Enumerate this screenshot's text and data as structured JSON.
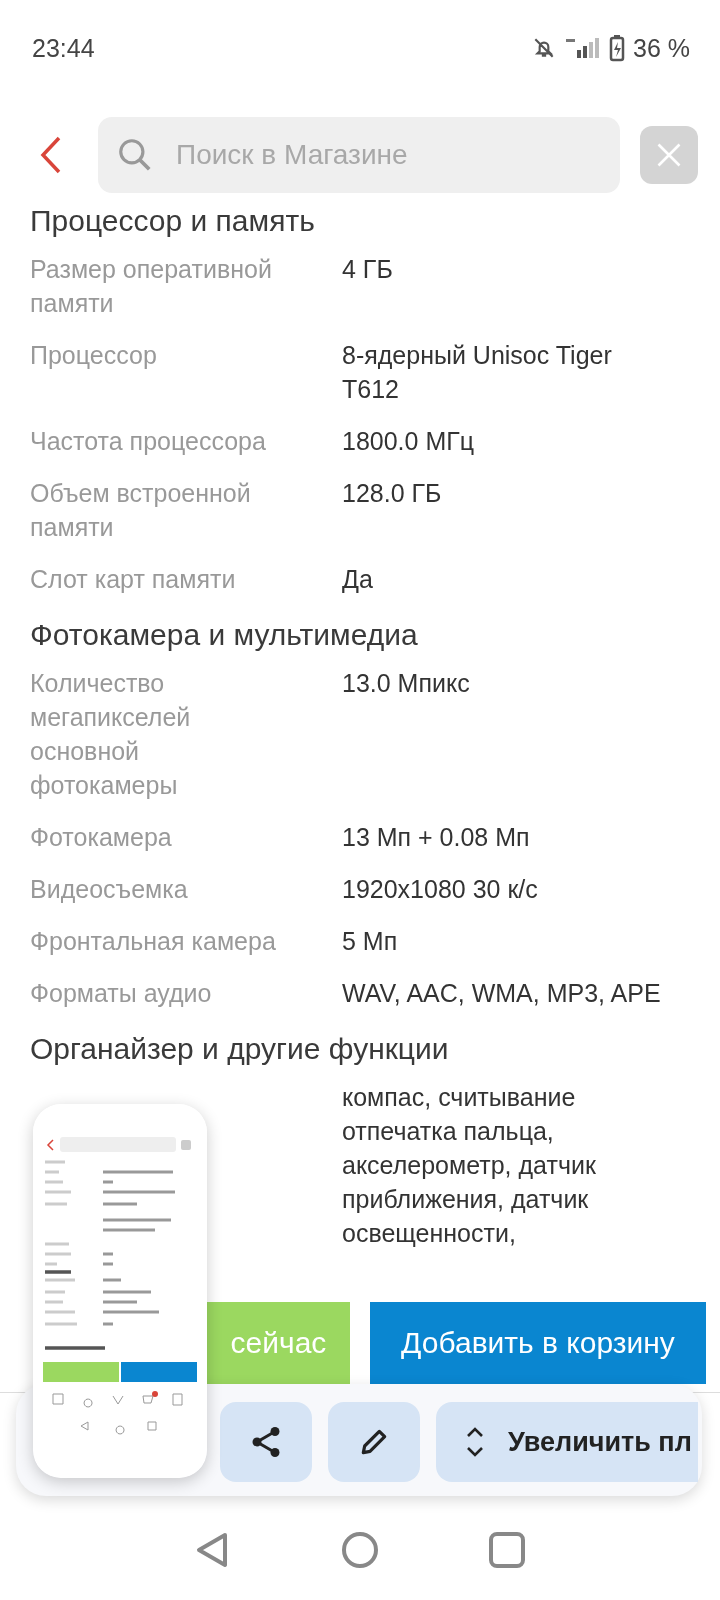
{
  "status_bar": {
    "time": "23:44",
    "battery": "36 %"
  },
  "header": {
    "search": {
      "placeholder": "Поиск в Магазине"
    }
  },
  "sections": [
    {
      "title": "Процессор и память",
      "rows": [
        {
          "label": "Размер оперативной памяти",
          "value": "4 ГБ"
        },
        {
          "label": "Процессор",
          "value": "8-ядерный Unisoc Tiger T612"
        },
        {
          "label": "Частота процессора",
          "value": "1800.0 МГц"
        },
        {
          "label": "Объем встроенной памяти",
          "value": "128.0 ГБ"
        },
        {
          "label": "Слот карт памяти",
          "value": "Да"
        }
      ]
    },
    {
      "title": "Фотокамера и мультимедиа",
      "rows": [
        {
          "label": "Количество мегапикселей основной фотокамеры",
          "value": "13.0 Мпикс"
        },
        {
          "label": "Фотокамера",
          "value": "13 Мп + 0.08 Мп"
        },
        {
          "label": "Видеосъемка",
          "value": "1920x1080 30 к/с"
        },
        {
          "label": "Фронтальная камера",
          "value": "5 Мп"
        },
        {
          "label": "Форматы аудио",
          "value": "WAV, AAC, WMA, MP3, APE"
        }
      ]
    },
    {
      "title": "Органайзер и другие функции",
      "rows": [
        {
          "value": "компас, считывание отпечатка пальца, акселерометр, датчик приближения, датчик освещенности,"
        }
      ]
    }
  ],
  "buy_buttons": [
    {
      "kind": "buy",
      "label": "сейчас"
    },
    {
      "kind": "cart",
      "label": "Добавить в корзину"
    }
  ],
  "screenshot_toolbar": {
    "actions": [
      {
        "kind": "share"
      },
      {
        "kind": "edit"
      },
      {
        "kind": "scroll",
        "label": "Увеличить пл"
      }
    ]
  }
}
